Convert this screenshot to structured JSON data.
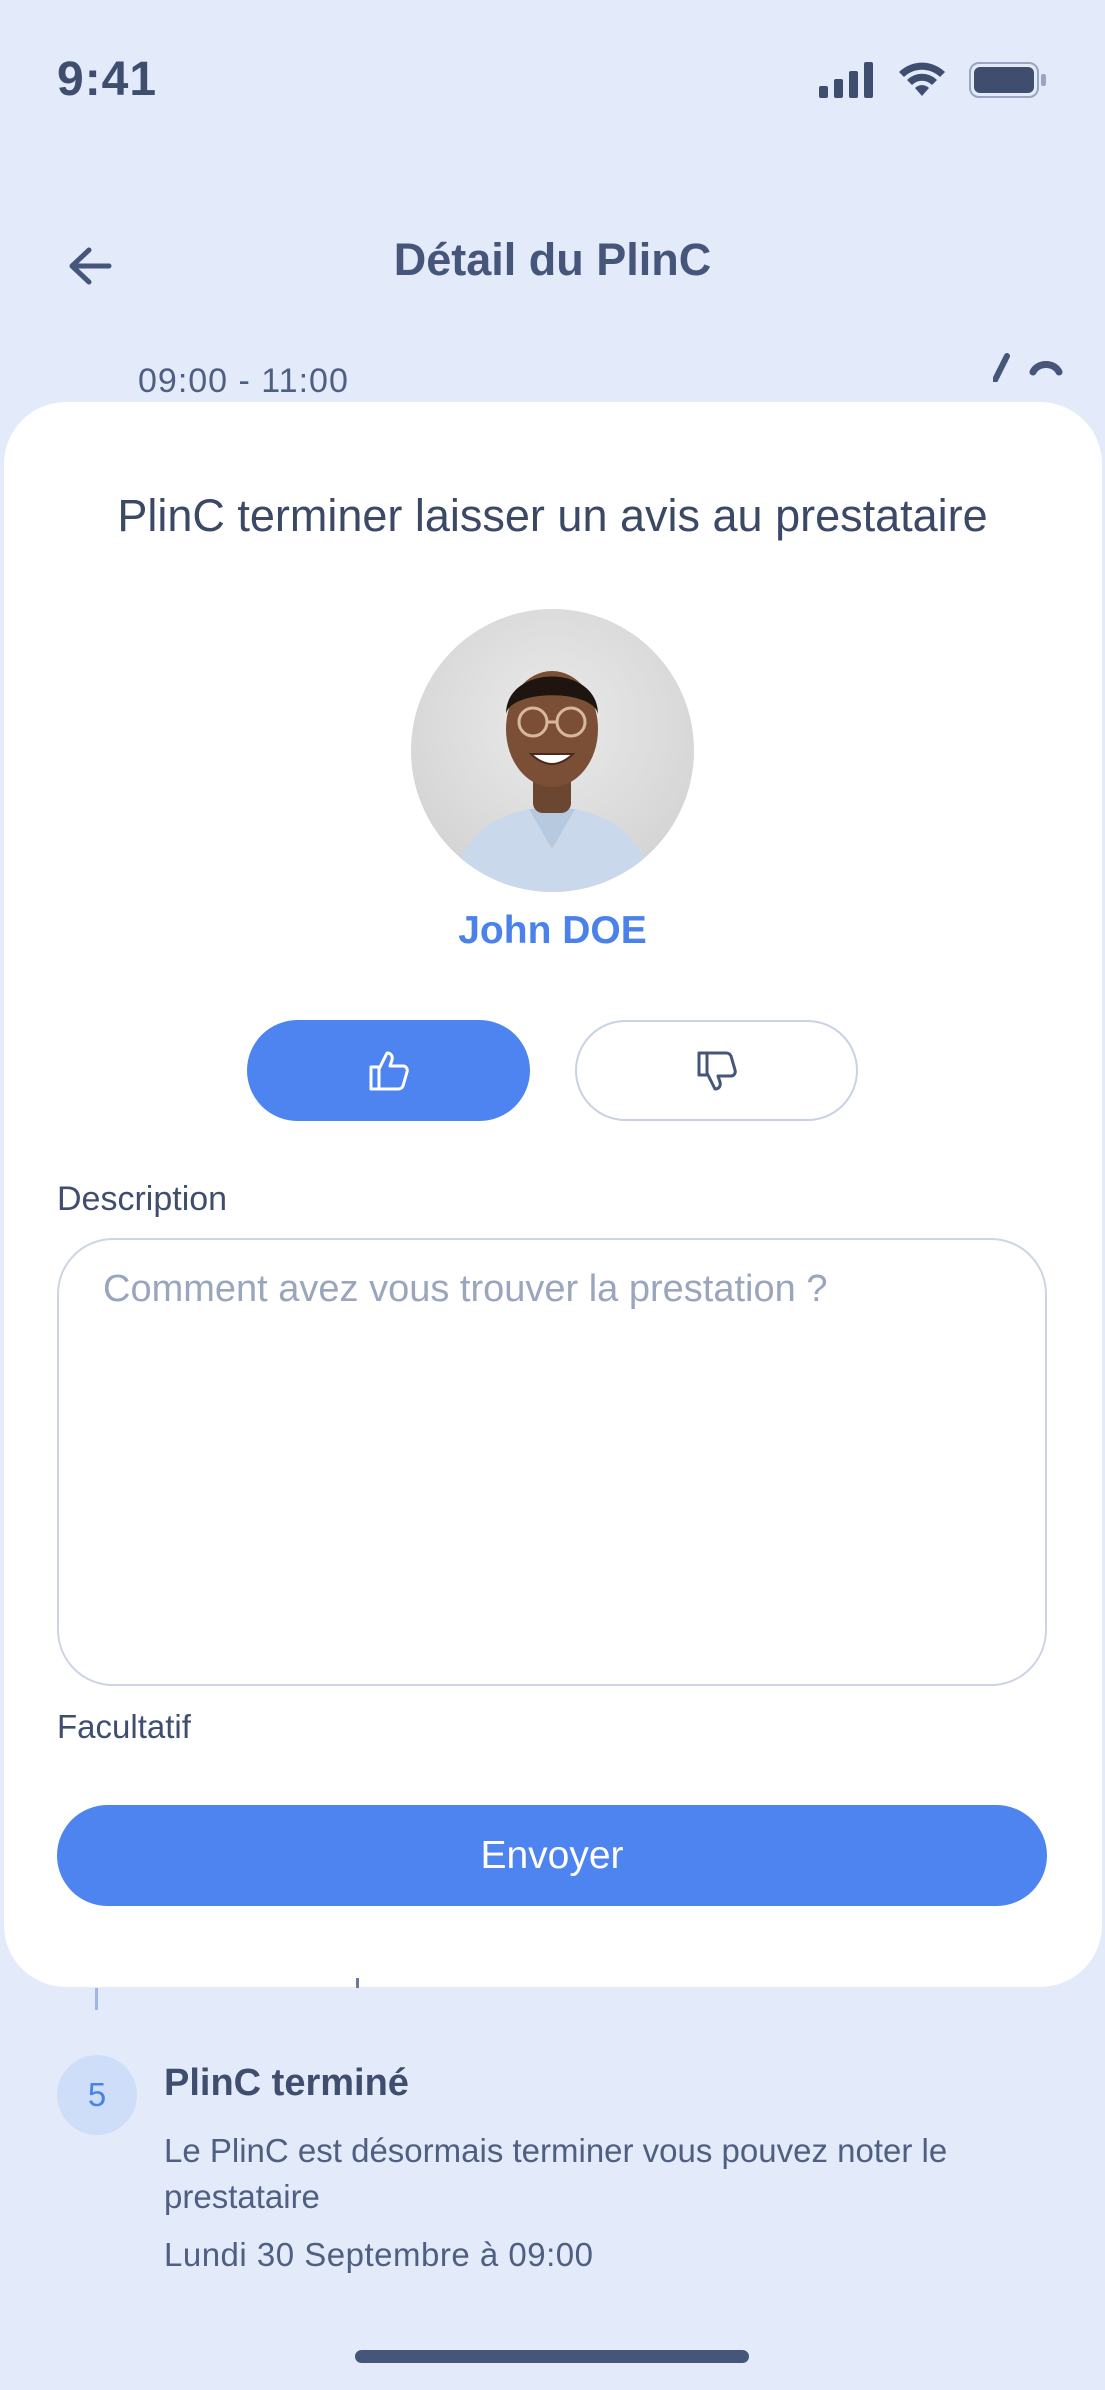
{
  "status_bar": {
    "time": "9:41"
  },
  "header": {
    "title": "Détail du PlinC"
  },
  "background": {
    "time_range": "09:00 - 11:00",
    "step": {
      "number": "5",
      "title": "PlinC terminé",
      "description": "Le PlinC est désormais terminer vous pouvez noter le prestataire",
      "date": "Lundi 30 Septembre à 09:00"
    }
  },
  "review_sheet": {
    "title": "PlinC terminer laisser un avis au prestataire",
    "provider_name": "John DOE",
    "selected_vote": "thumbs-up",
    "description_label": "Description",
    "description_placeholder": "Comment avez vous trouver la prestation ?",
    "description_value": "",
    "helper_text": "Facultatif",
    "submit_label": "Envoyer"
  },
  "colors": {
    "primary": "#4d84ef",
    "background": "#e3ebfa",
    "text": "#3f4e6e"
  }
}
